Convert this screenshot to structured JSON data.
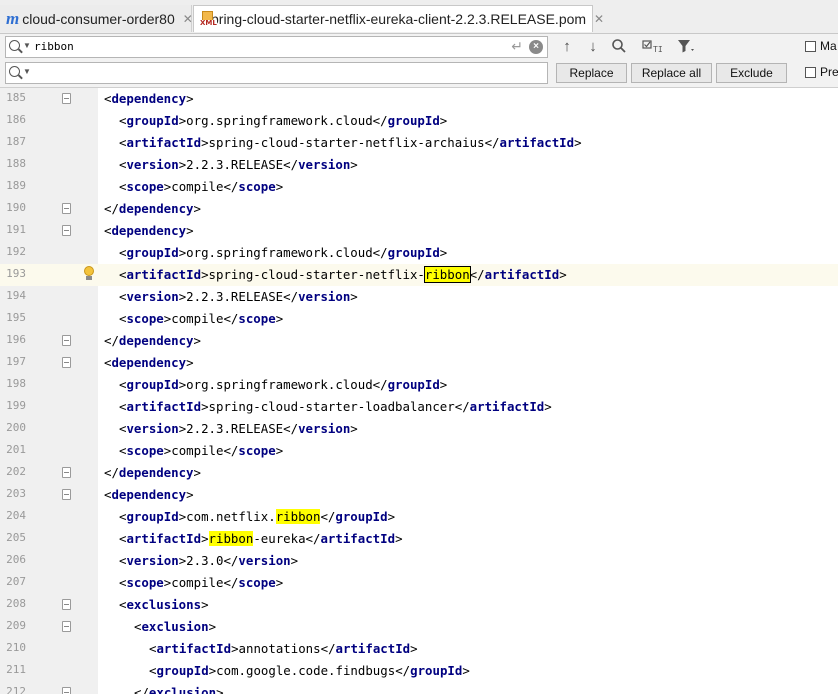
{
  "tabs": [
    {
      "label": "cloud-consumer-order80",
      "icon": "maven-module-icon",
      "active": false
    },
    {
      "label": "spring-cloud-starter-netflix-eureka-client-2.2.3.RELEASE.pom",
      "icon": "xml-file-icon",
      "active": true
    }
  ],
  "search": {
    "find_value": "ribbon",
    "replace_value": "",
    "buttons": {
      "replace": "Replace",
      "replace_all": "Replace all",
      "exclude": "Exclude"
    },
    "options": {
      "match_case": "Ma",
      "preserve_case": "Pre"
    }
  },
  "colors": {
    "tag": "#000080",
    "highlight": "#ffff00",
    "current_line": "#fcfaed",
    "gutter": "#f0f0f0"
  },
  "editor": {
    "lines": [
      {
        "no": "185",
        "indent": 0,
        "pre": "",
        "tag": "dependency",
        "text": "",
        "close": "",
        "fold": true
      },
      {
        "no": "186",
        "indent": 1,
        "pre": "",
        "tag": "groupId",
        "text": "org.springframework.cloud",
        "close": "groupId"
      },
      {
        "no": "187",
        "indent": 1,
        "pre": "",
        "tag": "artifactId",
        "text": "spring-cloud-starter-netflix-archaius",
        "close": "artifactId"
      },
      {
        "no": "188",
        "indent": 1,
        "pre": "",
        "tag": "version",
        "text": "2.2.3.RELEASE",
        "close": "version"
      },
      {
        "no": "189",
        "indent": 1,
        "pre": "",
        "tag": "scope",
        "text": "compile",
        "close": "scope"
      },
      {
        "no": "190",
        "indent": 0,
        "pre": "/",
        "tag": "dependency",
        "text": "",
        "close": "",
        "fold": true
      },
      {
        "no": "191",
        "indent": 0,
        "pre": "",
        "tag": "dependency",
        "text": "",
        "close": "",
        "fold": true
      },
      {
        "no": "192",
        "indent": 1,
        "pre": "",
        "tag": "groupId",
        "text": "org.springframework.cloud",
        "close": "groupId"
      },
      {
        "no": "193",
        "indent": 1,
        "pre": "",
        "tag": "artifactId",
        "text": "spring-cloud-starter-netflix-",
        "match": "ribbon",
        "after": "",
        "close": "artifactId",
        "current": true
      },
      {
        "no": "194",
        "indent": 1,
        "pre": "",
        "tag": "version",
        "text": "2.2.3.RELEASE",
        "close": "version"
      },
      {
        "no": "195",
        "indent": 1,
        "pre": "",
        "tag": "scope",
        "text": "compile",
        "close": "scope"
      },
      {
        "no": "196",
        "indent": 0,
        "pre": "/",
        "tag": "dependency",
        "text": "",
        "close": "",
        "fold": true
      },
      {
        "no": "197",
        "indent": 0,
        "pre": "",
        "tag": "dependency",
        "text": "",
        "close": "",
        "fold": true
      },
      {
        "no": "198",
        "indent": 1,
        "pre": "",
        "tag": "groupId",
        "text": "org.springframework.cloud",
        "close": "groupId"
      },
      {
        "no": "199",
        "indent": 1,
        "pre": "",
        "tag": "artifactId",
        "text": "spring-cloud-starter-loadbalancer",
        "close": "artifactId"
      },
      {
        "no": "200",
        "indent": 1,
        "pre": "",
        "tag": "version",
        "text": "2.2.3.RELEASE",
        "close": "version"
      },
      {
        "no": "201",
        "indent": 1,
        "pre": "",
        "tag": "scope",
        "text": "compile",
        "close": "scope"
      },
      {
        "no": "202",
        "indent": 0,
        "pre": "/",
        "tag": "dependency",
        "text": "",
        "close": "",
        "fold": true
      },
      {
        "no": "203",
        "indent": 0,
        "pre": "",
        "tag": "dependency",
        "text": "",
        "close": "",
        "fold": true
      },
      {
        "no": "204",
        "indent": 1,
        "pre": "",
        "tag": "groupId",
        "text": "com.netflix.",
        "match": "ribbon",
        "after": "",
        "close": "groupId"
      },
      {
        "no": "205",
        "indent": 1,
        "pre": "",
        "tag": "artifactId",
        "text": "",
        "match": "ribbon",
        "after": "-eureka",
        "close": "artifactId"
      },
      {
        "no": "206",
        "indent": 1,
        "pre": "",
        "tag": "version",
        "text": "2.3.0",
        "close": "version"
      },
      {
        "no": "207",
        "indent": 1,
        "pre": "",
        "tag": "scope",
        "text": "compile",
        "close": "scope"
      },
      {
        "no": "208",
        "indent": 1,
        "pre": "",
        "tag": "exclusions",
        "text": "",
        "close": "",
        "fold": true
      },
      {
        "no": "209",
        "indent": 2,
        "pre": "",
        "tag": "exclusion",
        "text": "",
        "close": "",
        "fold": true
      },
      {
        "no": "210",
        "indent": 3,
        "pre": "",
        "tag": "artifactId",
        "text": "annotations",
        "close": "artifactId"
      },
      {
        "no": "211",
        "indent": 3,
        "pre": "",
        "tag": "groupId",
        "text": "com.google.code.findbugs",
        "close": "groupId"
      },
      {
        "no": "212",
        "indent": 2,
        "pre": "/",
        "tag": "exclusion",
        "text": "",
        "close": "",
        "fold": true
      }
    ]
  }
}
